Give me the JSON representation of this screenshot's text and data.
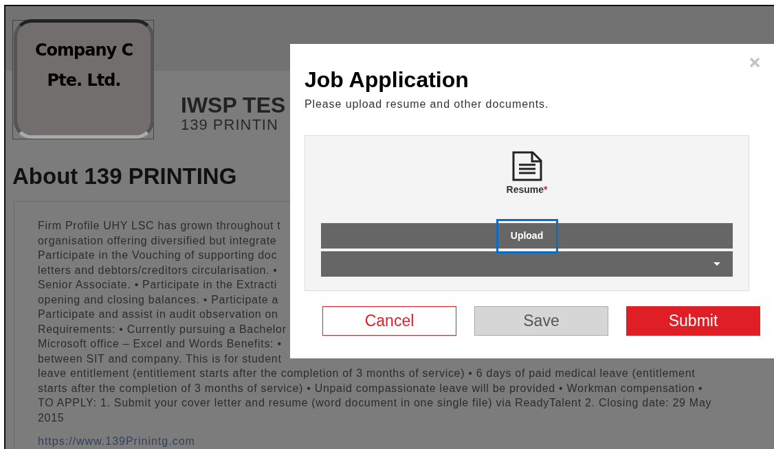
{
  "page": {
    "logo_lines": [
      "Company C",
      "Pte. Ltd."
    ],
    "header": {
      "title": "IWSP TES",
      "subtitle": "139 PRINTIN"
    },
    "about": {
      "heading": "About 139 PRINTING",
      "lines": [
        "Firm Profile UHY LSC has grown throughout t",
        "organisation offering diversified but integrate",
        "Participate in the Vouching of supporting doc",
        "letters and debtors/creditors circularisation. •",
        "Senior Associate. • Participate in the Extracti",
        "opening and closing balances. • Participate a",
        "Participate and assist in audit observation on",
        "Requirements: • Currently pursuing a Bachelor",
        "Microsoft office – Excel and Words Benefits: •",
        "between SIT and company. This is for student",
        "leave entitlement (entitlement starts after the completion of 3 months of service) • 6 days of paid medical leave (entitlement",
        "starts after the completion of 3 months of service) • Unpaid compassionate leave will be provided • Workman compensation •",
        "TO APPLY: 1. Submit your cover letter and resume (word document in one single file) via ReadyTalent 2. Closing date: 29 May",
        "2015"
      ],
      "link": "https://www.139Prinintg.com"
    }
  },
  "modal": {
    "title": "Job Application",
    "subtitle": "Please upload resume and other documents.",
    "document": {
      "label": "Resume",
      "required": true,
      "required_mark": "*",
      "upload_button": "Upload",
      "upload_focused": true
    },
    "buttons": [
      {
        "label": "Cancel",
        "kind": "outline"
      },
      {
        "label": "Save",
        "kind": "secondary"
      },
      {
        "label": "Submit",
        "kind": "primary"
      }
    ]
  }
}
